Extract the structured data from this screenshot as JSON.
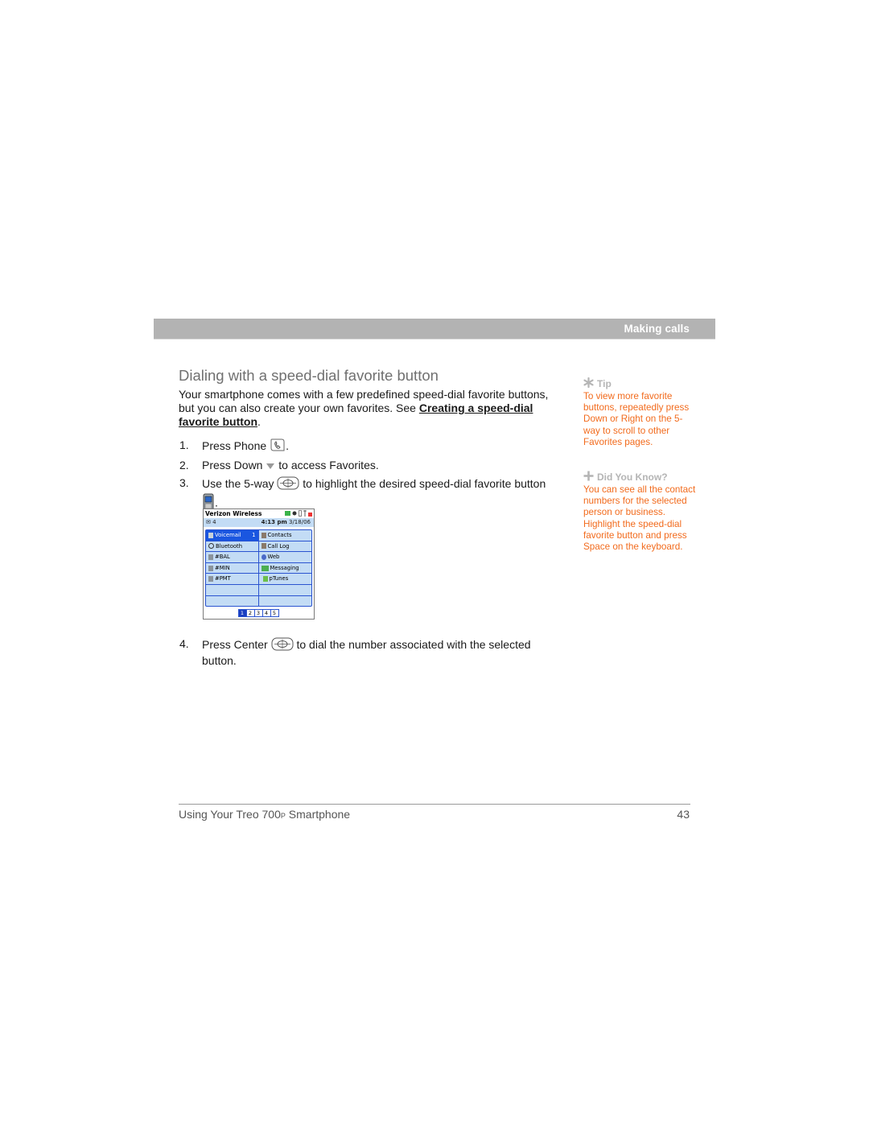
{
  "header": {
    "section_title": "Making calls"
  },
  "main": {
    "heading": "Dialing with a speed-dial favorite button",
    "intro_text": "Your smartphone comes with a few predefined speed-dial favorite buttons, but you can also create your own favorites. See ",
    "intro_link": "Creating a speed-dial favorite button",
    "intro_end": ".",
    "steps": [
      {
        "num": "1.",
        "before": "Press Phone",
        "icon": "phone-key-icon",
        "after": "."
      },
      {
        "num": "2.",
        "before": "Press Down",
        "icon": "down-arrow-icon",
        "after": "to access Favorites."
      },
      {
        "num": "3.",
        "before": "Use the 5-way",
        "icon": "five-way-navigator-icon",
        "after": "to highlight the desired speed-dial favorite button",
        "icon2": "favorite-button-icon",
        "after2": "."
      },
      {
        "num": "4.",
        "before": "Press Center",
        "icon": "five-way-center-icon",
        "after": "to dial the number associated with the selected button."
      }
    ]
  },
  "phone_screen": {
    "carrier": "Verizon Wireless",
    "messages_count": "4",
    "time": "4:13 pm",
    "date": "3/18/06",
    "favorites": [
      {
        "label": "Voicemail",
        "badge": "1",
        "icon": "voicemail-icon",
        "selected": true
      },
      {
        "label": "Contacts",
        "icon": "contacts-icon"
      },
      {
        "label": "Bluetooth",
        "icon": "bluetooth-icon"
      },
      {
        "label": "Call Log",
        "icon": "call-log-icon"
      },
      {
        "label": "#BAL",
        "icon": "phone-icon"
      },
      {
        "label": "Web",
        "icon": "web-icon"
      },
      {
        "label": "#MIN",
        "icon": "phone-icon"
      },
      {
        "label": "Messaging",
        "icon": "messaging-icon"
      },
      {
        "label": "#PMT",
        "icon": "phone-icon"
      },
      {
        "label": "pTunes",
        "icon": "ptunes-icon"
      },
      {
        "label": ""
      },
      {
        "label": ""
      },
      {
        "label": ""
      },
      {
        "label": ""
      }
    ],
    "pages": [
      "1",
      "2",
      "3",
      "4",
      "5"
    ],
    "active_page": "1"
  },
  "sidebar": {
    "tip": {
      "title": "Tip",
      "body": "To view more favorite buttons, repeatedly press Down or Right on the 5-way to scroll to other Favorites pages."
    },
    "did_you_know": {
      "title": "Did You Know?",
      "body": "You can see all the contact numbers for the selected person or business. Highlight the speed-dial favorite button and press Space on the keyboard."
    }
  },
  "footer": {
    "title_before": "Using Your Treo 700",
    "title_small": "P",
    "title_after": " Smartphone",
    "page_number": "43"
  },
  "colors": {
    "header_bar": "#b3b3b3",
    "sidebar_text": "#f26b1d",
    "sidebar_title": "#b5b5b5",
    "selection_blue": "#1a56e0"
  }
}
